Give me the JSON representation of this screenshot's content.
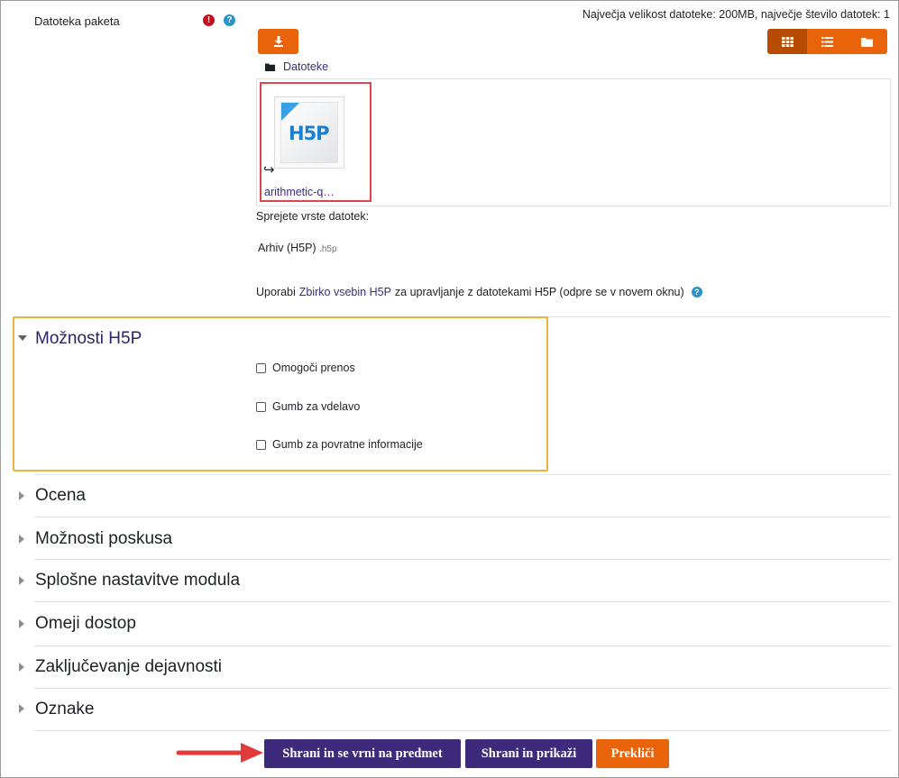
{
  "package": {
    "label": "Datoteka paketa",
    "required_icon": "exclamation-circle-icon",
    "help_icon": "question-circle-icon",
    "max_size_text": "Največja velikost datoteke: 200MB, največje število datotek: 1"
  },
  "file_manager": {
    "path_label": "Datoteke",
    "file_name": "arithmetic-q…",
    "thumb_logo": "H5P",
    "accepted_label": "Sprejete vrste datotek:",
    "accepted_type": "Arhiv (H5P)",
    "accepted_ext": ".h5p",
    "use_before": "Uporabi",
    "use_link": "Zbirko vsebin H5P",
    "use_after": "za upravljanje z datotekami H5P (odpre se v novem oknu)"
  },
  "h5p_options": {
    "title": "Možnosti H5P",
    "checkboxes": [
      {
        "label": "Omogoči prenos",
        "checked": false
      },
      {
        "label": "Gumb za vdelavo",
        "checked": false
      },
      {
        "label": "Gumb za povratne informacije",
        "checked": false
      }
    ]
  },
  "sections": [
    {
      "title": "Ocena"
    },
    {
      "title": "Možnosti poskusa"
    },
    {
      "title": "Splošne nastavitve modula"
    },
    {
      "title": "Omeji dostop"
    },
    {
      "title": "Zaključevanje dejavnosti"
    },
    {
      "title": "Oznake"
    }
  ],
  "buttons": {
    "save_return": "Shrani in se vrni na predmet",
    "save_display": "Shrani in prikaži",
    "cancel": "Prekliči"
  },
  "colors": {
    "accent_orange": "#e8630a",
    "primary_purple": "#3d2a7a",
    "highlight_red": "#e0434b",
    "highlight_yellow": "#f0b33a"
  }
}
